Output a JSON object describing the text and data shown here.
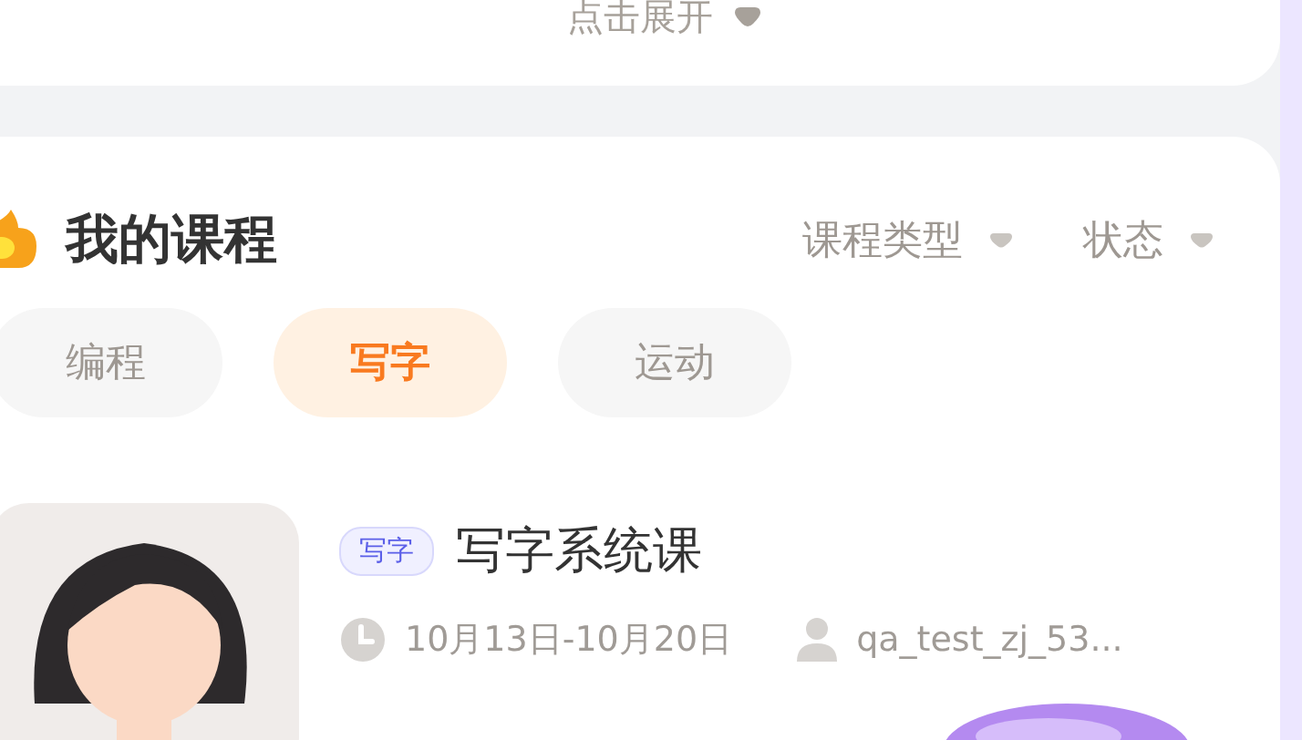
{
  "expand_card": {
    "label": "点击展开"
  },
  "courses_section": {
    "title": "我的课程",
    "filters": [
      {
        "label": "课程类型"
      },
      {
        "label": "状态"
      }
    ],
    "categories": [
      {
        "label": "编程",
        "selected": false
      },
      {
        "label": "写字",
        "selected": true
      },
      {
        "label": "运动",
        "selected": false
      }
    ],
    "courses": [
      {
        "tag": "写字",
        "title": "写字系统课",
        "dates": "10月13日-10月20日",
        "teacher": "qa_test_zj_53..."
      }
    ]
  }
}
